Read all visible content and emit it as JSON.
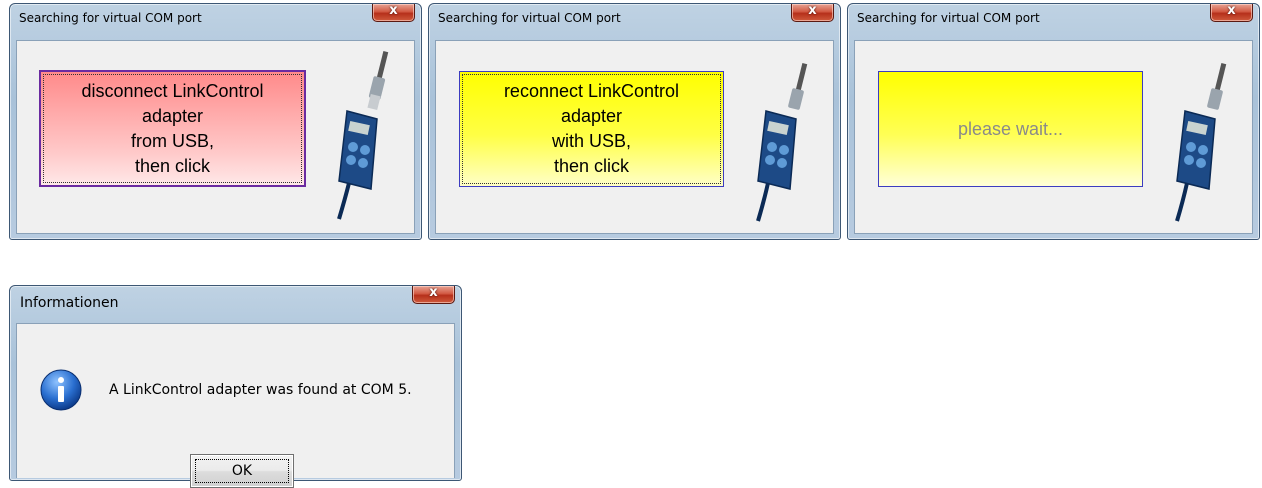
{
  "dialogs": [
    {
      "title": "Searching for virtual COM port",
      "close_label": "x",
      "prompt": "disconnect LinkControl\nadapter\nfrom USB,\nthen click",
      "prompt_color": "#ff9090"
    },
    {
      "title": "Searching for virtual COM port",
      "close_label": "x",
      "prompt": "reconnect LinkControl\nadapter\nwith USB,\nthen click",
      "prompt_color": "#ffff00"
    },
    {
      "title": "Searching for virtual COM port",
      "close_label": "x",
      "prompt": "please wait...",
      "prompt_color": "#ffff00"
    }
  ],
  "info_dialog": {
    "title": "Informationen",
    "close_label": "x",
    "icon": "info-icon",
    "message": "A LinkControl adapter was found at COM 5.",
    "ok_label": "OK"
  },
  "colors": {
    "title_bar": "#b4c9de",
    "close_button": "#c8442b",
    "client_bg": "#f0f0f0",
    "device_body": "#1d4a86"
  }
}
